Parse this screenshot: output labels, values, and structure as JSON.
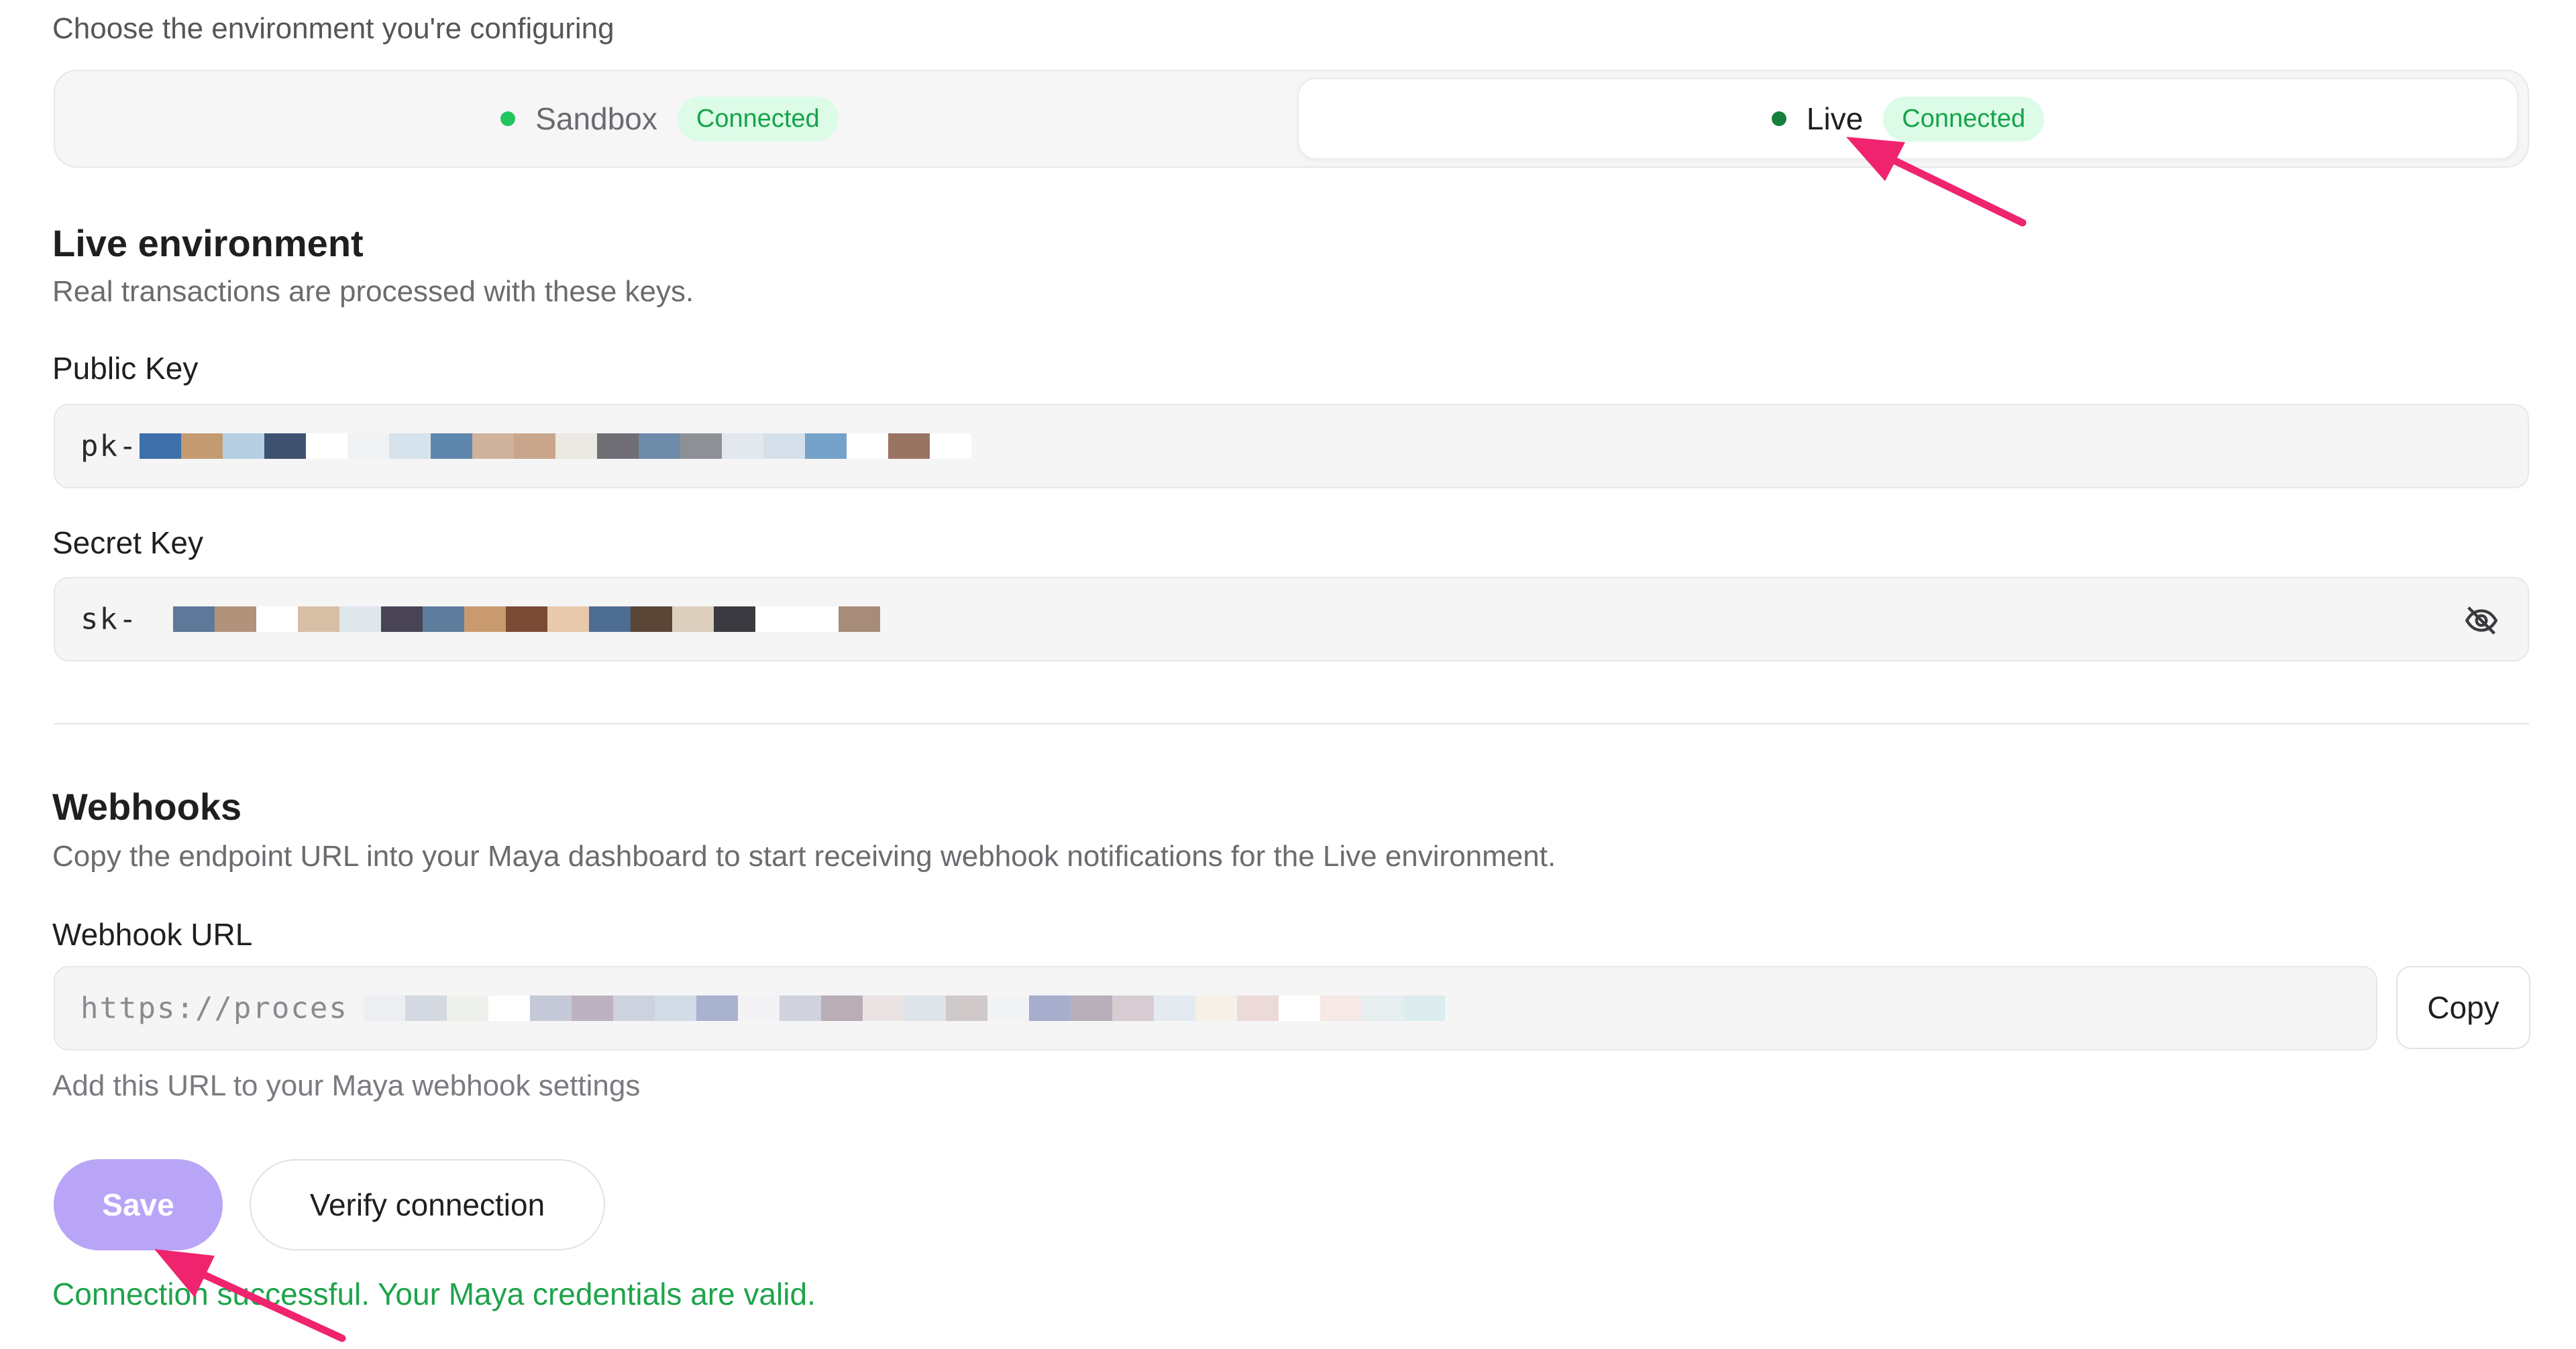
{
  "environment": {
    "prompt": "Choose the environment you're configuring",
    "options": [
      {
        "name": "Sandbox",
        "status": "Connected",
        "dot_color": "#22c55e"
      },
      {
        "name": "Live",
        "status": "Connected",
        "dot_color": "#15803d"
      }
    ],
    "selected": "Live"
  },
  "live": {
    "title": "Live environment",
    "description": "Real transactions are processed with these keys.",
    "public_key_label": "Public Key",
    "public_key_value": "pk-",
    "secret_key_label": "Secret Key",
    "secret_key_value": "sk-"
  },
  "webhooks": {
    "title": "Webhooks",
    "description": "Copy the endpoint URL into your Maya dashboard to start receiving webhook notifications for the Live environment.",
    "url_label": "Webhook URL",
    "url_value": "https://proces",
    "copy_label": "Copy",
    "hint": "Add this URL to your Maya webhook settings"
  },
  "actions": {
    "save_label": "Save",
    "verify_label": "Verify connection"
  },
  "status_message": "Connection successful. Your Maya credentials are valid.",
  "colors": {
    "accent": "#b9a5f7",
    "success": "#1ea34a",
    "badge_bg": "#dcfce7",
    "annotation_arrow": "#f0246e"
  },
  "icons": {
    "secret_visibility": "eye-off-icon"
  }
}
